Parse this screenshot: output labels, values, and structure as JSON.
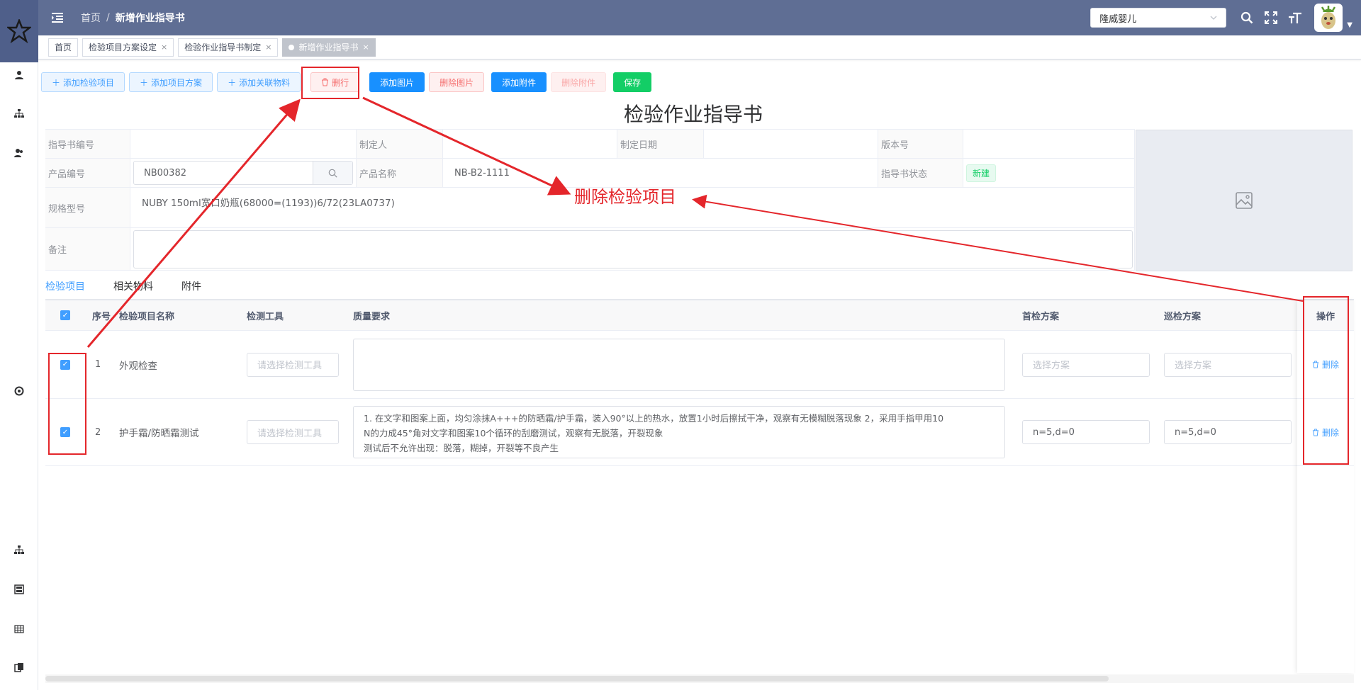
{
  "topbar": {
    "breadcrumb": [
      "首页",
      "新增作业指导书"
    ],
    "breadcrumb_sep": "/",
    "org_select": "隆威婴儿"
  },
  "tags": [
    {
      "label": "首页",
      "closable": false,
      "active": false
    },
    {
      "label": "检验项目方案设定",
      "closable": true,
      "active": false
    },
    {
      "label": "检验作业指导书制定",
      "closable": true,
      "active": false
    },
    {
      "label": "新增作业指导书",
      "closable": true,
      "active": true
    }
  ],
  "tag_close": "×",
  "toolbar": {
    "add_item": "添加检验项目",
    "add_plan": "添加项目方案",
    "add_material": "添加关联物料",
    "delete_row": "删行",
    "add_image": "添加图片",
    "delete_image": "删除图片",
    "add_attachment": "添加附件",
    "delete_attachment": "删除附件",
    "save": "保存"
  },
  "doc_title": "检验作业指导书",
  "form": {
    "guide_no_label": "指导书编号",
    "guide_no": "",
    "maker_label": "制定人",
    "maker": "",
    "date_label": "制定日期",
    "date": "",
    "version_label": "版本号",
    "version": "",
    "product_code_label": "产品编号",
    "product_code": "NB00382",
    "product_name_label": "产品名称",
    "product_name": "NB-B2-1111",
    "status_label": "指导书状态",
    "status": "新建",
    "spec_label": "规格型号",
    "spec": "NUBY 150ml宽口奶瓶(68000=(1193))6/72(23LA0737)",
    "remark_label": "备注",
    "remark": ""
  },
  "tabs": [
    "检验项目",
    "相关物料",
    "附件"
  ],
  "table": {
    "headers": {
      "seq": "序号",
      "name": "检验项目名称",
      "tool": "检测工具",
      "quality": "质量要求",
      "first": "首检方案",
      "patrol": "巡检方案",
      "op": "操作"
    },
    "rows": [
      {
        "seq": "1",
        "name": "外观检查",
        "tool_placeholder": "请选择检测工具",
        "quality": "",
        "first": "选择方案",
        "patrol": "选择方案",
        "op": "删除"
      },
      {
        "seq": "2",
        "name": "护手霜/防晒霜测试",
        "tool_placeholder": "请选择检测工具",
        "quality_lines": [
          "1. 在文字和图案上面，均匀涂抹A+++的防晒霜/护手霜，装入90°以上的热水，放置1小时后擦拭干净，观察有无模糊脱落现象 2，采用手指甲用10",
          "N的力成45°角对文字和图案10个循环的刮磨测试，观察有无脱落，开裂现象",
          "测试后不允许出现：脱落，糊掉，开裂等不良产生"
        ],
        "first": "n=5,d=0",
        "patrol": "n=5,d=0",
        "op": "删除"
      }
    ]
  },
  "annotation": "删除检验项目",
  "colors": {
    "topbar": "#5f6e94",
    "primary": "#409eff",
    "danger": "#f56c6c",
    "success": "#13ce66",
    "annotation": "#e4262b"
  }
}
